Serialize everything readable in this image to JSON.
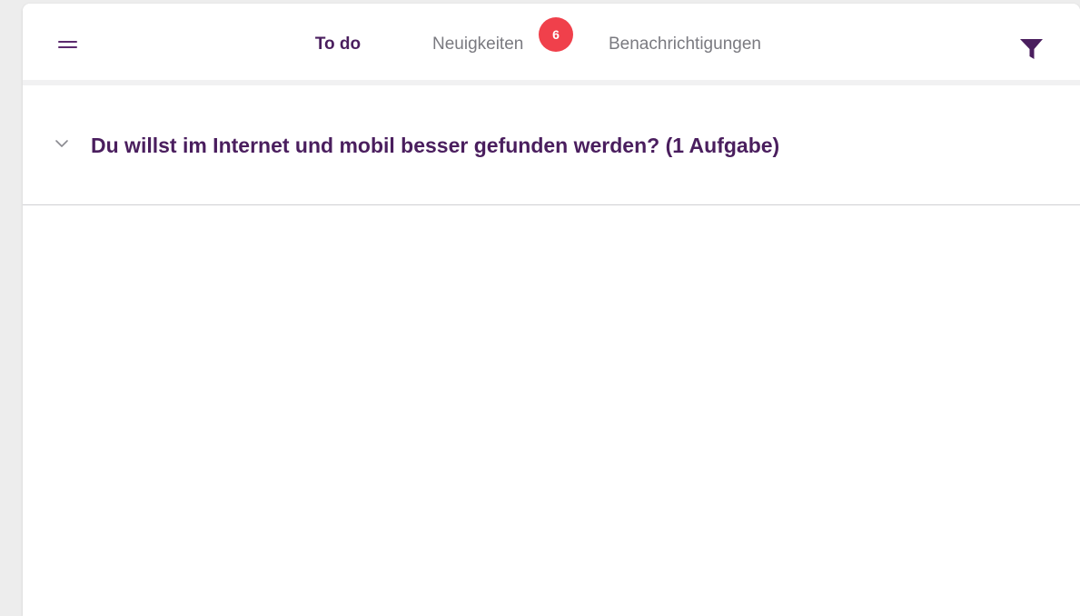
{
  "colors": {
    "brand": "#4a1e5e",
    "badge": "#f0404b",
    "inactive_tab": "#7a7a80"
  },
  "header": {
    "menu_icon": "hamburger-menu-icon",
    "filter_icon": "filter-icon",
    "tabs": [
      {
        "label": "To do",
        "active": true
      },
      {
        "label": "Neuigkeiten",
        "active": false,
        "badge": "6"
      },
      {
        "label": "Benachrichtigungen",
        "active": false
      }
    ]
  },
  "main": {
    "sections": [
      {
        "title": "Du willst im Internet und mobil besser gefunden werden? (1 Aufgabe)",
        "expanded": false,
        "icon": "chevron-down-icon"
      }
    ]
  }
}
